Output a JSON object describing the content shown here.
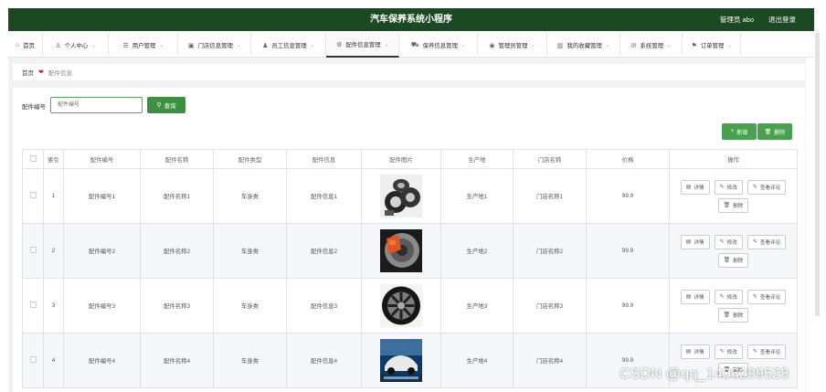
{
  "header": {
    "title": "汽车保养系统小程序",
    "user": "管理员 abo",
    "logout": "退出登录"
  },
  "nav": [
    {
      "label": "首页",
      "icon": "home-icon",
      "glyph": "⌂",
      "dropdown": false,
      "active": false,
      "w": 38
    },
    {
      "label": "个人中心",
      "icon": "user-icon",
      "glyph": "♙",
      "dropdown": true,
      "active": false,
      "w": 72
    },
    {
      "label": "用户管理",
      "icon": "list-icon",
      "glyph": "☰",
      "dropdown": true,
      "active": false,
      "w": 76
    },
    {
      "label": "门店信息管理",
      "icon": "store-icon",
      "glyph": "▣",
      "dropdown": true,
      "active": false,
      "w": 80
    },
    {
      "label": "员工信息管理",
      "icon": "person-icon",
      "glyph": "♟",
      "dropdown": true,
      "active": false,
      "w": 82
    },
    {
      "label": "配件信息管理",
      "icon": "wrench-icon",
      "glyph": "⚙",
      "dropdown": true,
      "active": true,
      "w": 80
    },
    {
      "label": "保养信息管理",
      "icon": "car-icon",
      "glyph": "⛟",
      "dropdown": true,
      "active": false,
      "w": 86
    },
    {
      "label": "管理员管理",
      "icon": "location-icon",
      "glyph": "◉",
      "dropdown": true,
      "active": false,
      "w": 76
    },
    {
      "label": "我的收藏管理",
      "icon": "chart-icon",
      "glyph": "▥",
      "dropdown": true,
      "active": false,
      "w": 80
    },
    {
      "label": "系统管理",
      "icon": "mail-icon",
      "glyph": "✉",
      "dropdown": true,
      "active": false,
      "w": 68
    },
    {
      "label": "订单管理",
      "icon": "flag-icon",
      "glyph": "⚑",
      "dropdown": true,
      "active": false,
      "w": 64
    }
  ],
  "breadcrumb": {
    "home": "首页",
    "current": "配件信息"
  },
  "search": {
    "label": "配件编号",
    "placeholder": "配件编号",
    "button": "查询"
  },
  "actions": {
    "add": "新增",
    "delete": "删除"
  },
  "table": {
    "columns": [
      "索引",
      "配件编号",
      "配件名称",
      "配件类型",
      "配件信息",
      "配件图片",
      "生产地",
      "门店名称",
      "价格",
      "操作"
    ],
    "rows": [
      {
        "index": "1",
        "code": "配件编号1",
        "name": "配件名称1",
        "type": "车身类",
        "info": "配件信息1",
        "image": "wheels",
        "origin": "生产地1",
        "store": "门店名称1",
        "price": "99.9"
      },
      {
        "index": "2",
        "code": "配件编号2",
        "name": "配件名称2",
        "type": "车身类",
        "info": "配件信息2",
        "image": "brake",
        "origin": "生产地2",
        "store": "门店名称2",
        "price": "99.9"
      },
      {
        "index": "3",
        "code": "配件编号3",
        "name": "配件名称3",
        "type": "车身类",
        "info": "配件信息3",
        "image": "rim",
        "origin": "生产地3",
        "store": "门店名称3",
        "price": "99.9"
      },
      {
        "index": "4",
        "code": "配件编号4",
        "name": "配件名称4",
        "type": "车身类",
        "info": "配件信息4",
        "image": "car",
        "origin": "生产地4",
        "store": "门店名称4",
        "price": "99.9"
      }
    ],
    "row_ops": {
      "detail": "详情",
      "edit": "修改",
      "review": "查看评论",
      "remove": "删除"
    }
  },
  "watermark": "CSDN @qq_1406299528",
  "colors": {
    "header": "#1b4a22",
    "primary_button": "#3d8f41",
    "accent_red": "#e02020"
  }
}
